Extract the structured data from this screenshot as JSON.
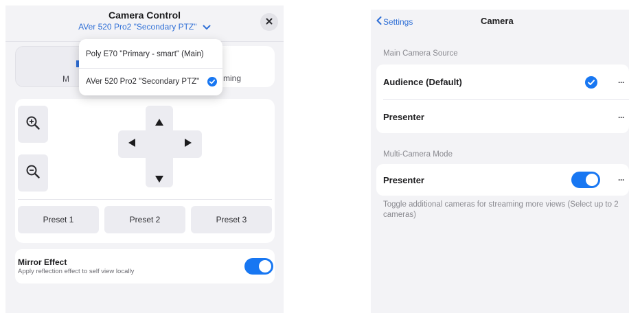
{
  "left_panel": {
    "title": "Camera Control",
    "subtitle": "AVer 520 Pro2 \"Secondary PTZ\"",
    "tabs": {
      "left_label_fragment": "M",
      "right_label_fragment": "ming"
    },
    "presets": [
      "Preset 1",
      "Preset 2",
      "Preset 3"
    ],
    "mirror": {
      "title": "Mirror Effect",
      "description": "Apply reflection effect to self view locally",
      "enabled": true
    },
    "dropdown": {
      "options": [
        {
          "label": "Poly E70 \"Primary - smart\" (Main)",
          "selected": false
        },
        {
          "label": "AVer 520 Pro2 \"Secondary PTZ\"",
          "selected": true
        }
      ]
    }
  },
  "right_panel": {
    "back_label": "Settings",
    "title": "Camera",
    "main_source": {
      "section_label": "Main Camera Source",
      "rows": [
        {
          "label": "Audience (Default)",
          "selected": true
        },
        {
          "label": "Presenter",
          "selected": false
        }
      ]
    },
    "multi_camera": {
      "section_label": "Multi-Camera Mode",
      "row_label": "Presenter",
      "enabled": true,
      "help_text": "Toggle additional cameras for streaming more views (Select up to 2 cameras)"
    },
    "more_glyph": "···"
  },
  "colors": {
    "accent": "#1877f2",
    "link": "#2f6fd6",
    "panel_bg": "#f3f3f6",
    "button_bg": "#ececf1"
  }
}
